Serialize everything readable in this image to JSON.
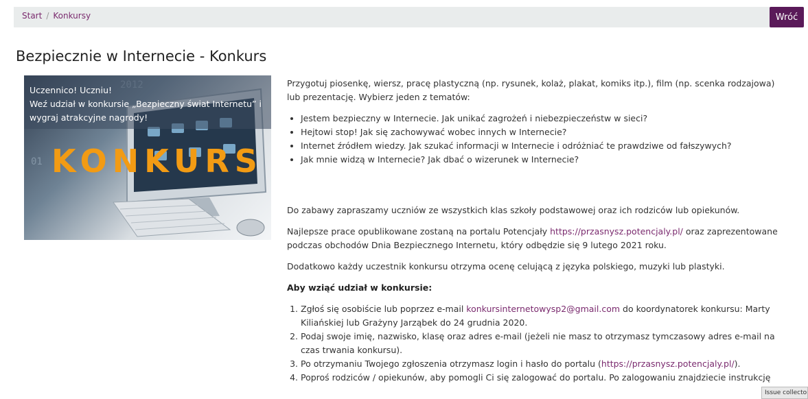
{
  "breadcrumb": {
    "start": "Start",
    "separator": "/",
    "current": "Konkursy"
  },
  "back_button": "Wróć",
  "page_title": "Bezpiecznie w Internecie - Konkurs",
  "hero": {
    "line1": "Uczennico! Uczniu!",
    "line2": "Weź udział w konkursie „Bezpieczny świat Internetu” i",
    "line3": "wygraj atrakcyjne nagrody!",
    "big_word": "KONKURS"
  },
  "intro": "Przygotuj piosenkę, wiersz, pracę plastyczną (np. rysunek, kolaż, plakat, komiks itp.), film (np. scenka rodzajowa) lub prezentację. Wybierz jeden z tematów:",
  "topics": [
    "Jestem bezpieczny w Internecie. Jak unikać zagrożeń i niebezpieczeństw  w sieci?",
    "Hejtowi stop! Jak się zachowywać wobec innych w Internecie?",
    "Internet źródłem wiedzy. Jak szukać informacji w Internecie i odróżniać te prawdziwe od fałszywych?",
    "Jak mnie widzą w Internecie? Jak dbać o wizerunek w Internecie?"
  ],
  "invite": "Do zabawy zapraszamy uczniów ze wszystkich klas szkoły podstawowej oraz ich rodziców lub opiekunów.",
  "best_works": {
    "before": "Najlepsze prace opublikowane zostaną na portalu Potencjały ",
    "link": "https://przasnysz.potencjaly.pl/",
    "after": " oraz zaprezentowane podczas obchodów Dnia Bezpiecznego Internetu, który odbędzie się 9 lutego 2021 roku."
  },
  "grade": "Dodatkowo każdy uczestnik konkursu otrzyma ocenę celującą z języka polskiego, muzyki lub plastyki.",
  "how_to_heading": "Aby wziąć udział w konkursie:",
  "steps": {
    "s1_before": "Zgłoś się osobiście lub poprzez e-mail ",
    "s1_email": "konkursinternetowysp2@gmail.com",
    "s1_after": " do koordynatorek konkursu: Marty Kiliańskiej lub Grażyny Jarząbek do 24 grudnia 2020.",
    "s2": "Podaj swoje imię, nazwisko, klasę oraz adres e-mail (jeżeli nie masz to otrzymasz tymczasowy adres e-mail na czas trwania konkursu).",
    "s3_before": "Po otrzymaniu Twojego zgłoszenia otrzymasz login i hasło do portalu (",
    "s3_link": "https://przasnysz.potencjaly.pl/",
    "s3_after": ").",
    "s4": "Poproś rodziców / opiekunów, aby pomogli Ci się zalogować do portalu. Po zalogowaniu znajdziecie instrukcję"
  },
  "issue_collector": "Issue collector"
}
